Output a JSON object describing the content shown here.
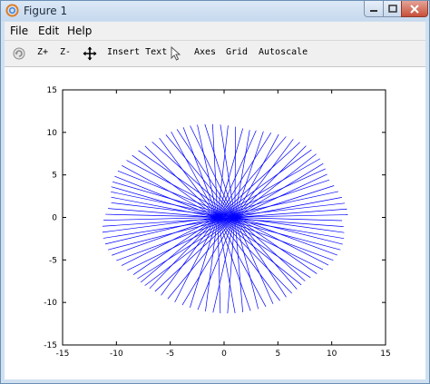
{
  "window": {
    "title": "Figure 1"
  },
  "menu": {
    "file": "File",
    "edit": "Edit",
    "help": "Help"
  },
  "toolbar": {
    "zoom_in": "Z+",
    "zoom_out": "Z-",
    "insert_text": "Insert Text",
    "axes": "Axes",
    "grid": "Grid",
    "autoscale": "Autoscale"
  },
  "colors": {
    "line": "#0000ff",
    "background": "#ffffff"
  },
  "chart_data": {
    "type": "line",
    "title": "",
    "xlabel": "",
    "ylabel": "",
    "xlim": [
      -15,
      15
    ],
    "ylim": [
      -15,
      15
    ],
    "xticks": [
      -15,
      -10,
      -5,
      0,
      5,
      10,
      15
    ],
    "yticks": [
      -15,
      -10,
      -5,
      0,
      5,
      10,
      15
    ],
    "grid": false,
    "legend": "none",
    "description_of_marks": "radial line segments",
    "series": [
      {
        "ray_count": 100,
        "center_offsets_x": [
          -0.6,
          1.0
        ],
        "outer_radius_x": 11.5,
        "outer_radius_y": 11.3
      }
    ]
  }
}
